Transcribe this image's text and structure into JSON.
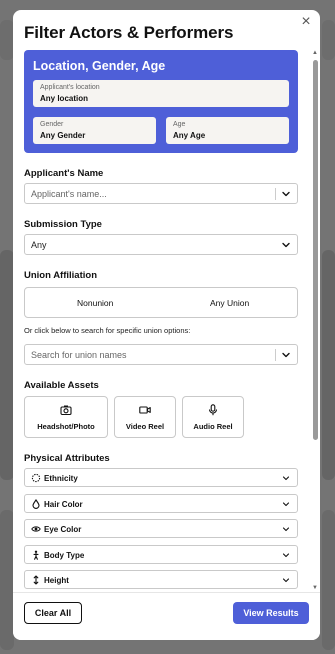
{
  "modal": {
    "title": "Filter Actors & Performers",
    "close_symbol": "×"
  },
  "location_card": {
    "title": "Location, Gender, Age",
    "location": {
      "label": "Applicant's location",
      "value": "Any location"
    },
    "gender": {
      "label": "Gender",
      "value": "Any Gender"
    },
    "age": {
      "label": "Age",
      "value": "Any Age"
    },
    "color": "#4e5fd8"
  },
  "applicant_name": {
    "label": "Applicant's Name",
    "placeholder": "Applicant's name..."
  },
  "submission_type": {
    "label": "Submission Type",
    "value": "Any"
  },
  "union": {
    "label": "Union Affiliation",
    "options": [
      "Nonunion",
      "Any Union"
    ],
    "note": "Or click below to search for specific union options:",
    "search_placeholder": "Search for union names"
  },
  "assets": {
    "label": "Available Assets",
    "items": [
      {
        "label": "Headshot/Photo",
        "icon": "camera-icon"
      },
      {
        "label": "Video Reel",
        "icon": "video-icon"
      },
      {
        "label": "Audio Reel",
        "icon": "microphone-icon"
      }
    ]
  },
  "physical": {
    "label": "Physical Attributes",
    "items": [
      {
        "label": "Ethnicity",
        "icon": "dotted-circle-icon"
      },
      {
        "label": "Hair Color",
        "icon": "drop-icon"
      },
      {
        "label": "Eye Color",
        "icon": "eye-icon"
      },
      {
        "label": "Body Type",
        "icon": "person-icon"
      },
      {
        "label": "Height",
        "icon": "vertical-arrows-icon"
      }
    ]
  },
  "footer": {
    "clear_label": "Clear All",
    "view_label": "View Results",
    "accent": "#4e5fd8"
  }
}
